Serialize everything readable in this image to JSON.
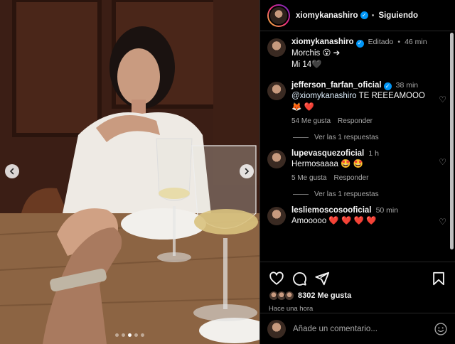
{
  "post": {
    "author": "xiomykanashiro",
    "follow_label": "Siguiendo",
    "separator": "•",
    "carousel": {
      "total_slides": 5,
      "active_slide": 3
    }
  },
  "caption": {
    "author": "xiomykanashiro",
    "edited_label": "Editado",
    "dot": "•",
    "time": "46 min",
    "line1": "Morchis 😮 ➔",
    "line2": "Mi 14🖤"
  },
  "comments": [
    {
      "author": "jefferson_farfan_oficial",
      "verified": true,
      "time": "38 min",
      "mention": "@xiomykanashiro",
      "text": " TE REEEAMOOO 🦊 ❤️",
      "likes": "54 Me gusta",
      "reply_label": "Responder",
      "view_replies": "Ver las 1 respuestas"
    },
    {
      "author": "lupevasquezoficial",
      "verified": false,
      "time": "1 h",
      "text": "Hermosaaaa 🤩 🤩",
      "likes": "5 Me gusta",
      "reply_label": "Responder",
      "view_replies": "Ver las 1 respuestas"
    },
    {
      "author": "lesliemoscosooficial",
      "verified": false,
      "time": "50 min",
      "text": "Amooooo ❤️ ❤️ ❤️ ❤️"
    }
  ],
  "actions": {
    "like_count": "8302 Me gusta",
    "posted_time": "Hace una hora"
  },
  "add_comment": {
    "placeholder": "Añade un comentario..."
  },
  "colors": {
    "background": "#000000",
    "text": "#f5f5f5",
    "secondary": "#a8a8a8",
    "verified": "#0095f6",
    "border": "#262626"
  },
  "icons": [
    "chevron-left-icon",
    "chevron-right-icon",
    "heart-icon",
    "comment-icon",
    "share-icon",
    "bookmark-icon",
    "smiley-icon",
    "verified-icon"
  ]
}
